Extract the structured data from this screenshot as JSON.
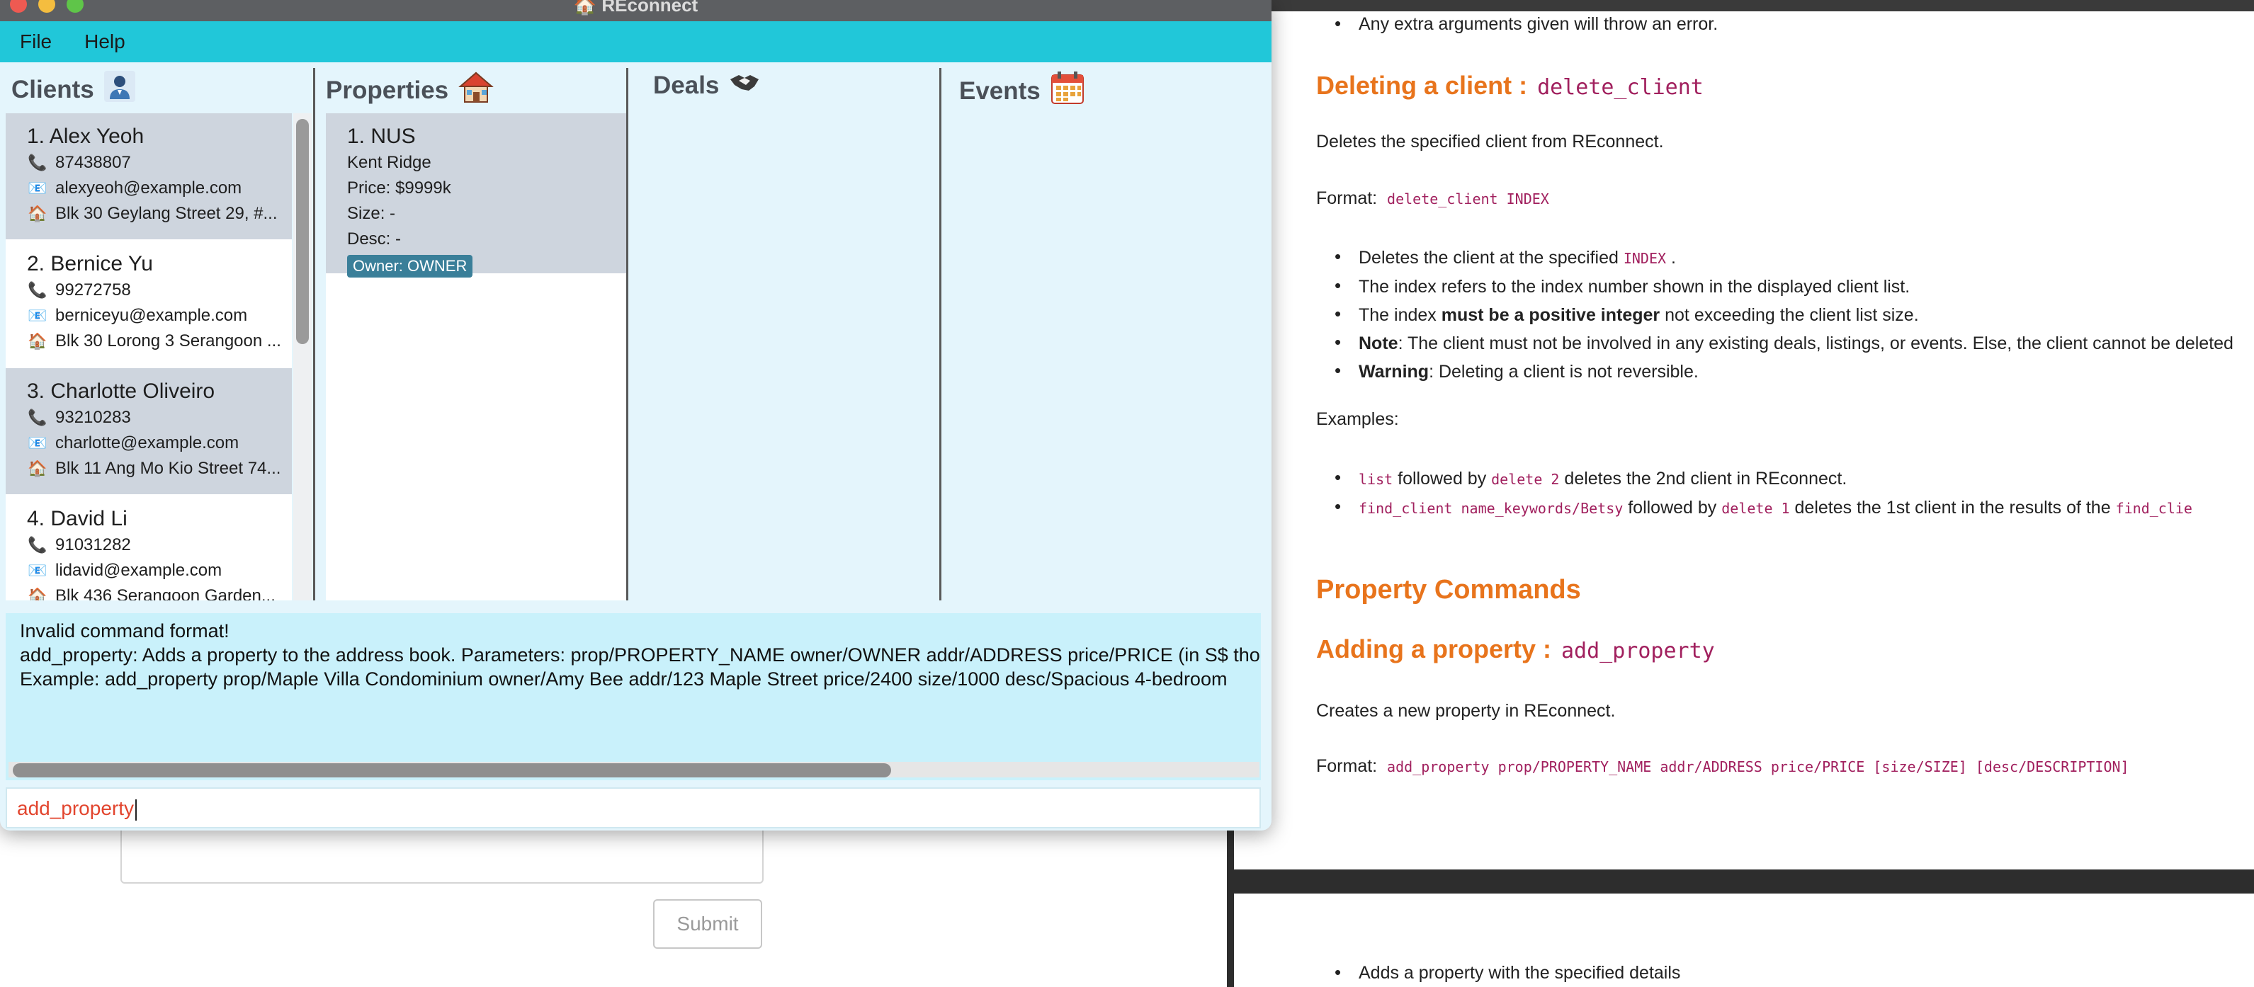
{
  "window": {
    "title": "REconnect"
  },
  "menu": [
    "File",
    "Help"
  ],
  "panels": {
    "clients": {
      "title": "Clients",
      "icon": "person-icon"
    },
    "properties": {
      "title": "Properties",
      "icon": "house-icon"
    },
    "deals": {
      "title": "Deals",
      "icon": "handshake-icon"
    },
    "events": {
      "title": "Events",
      "icon": "calendar-icon"
    }
  },
  "clients": [
    {
      "name": "1. Alex Yeoh",
      "phone": "87438807",
      "email": "alexyeoh@example.com",
      "address": "Blk 30 Geylang Street 29, #..."
    },
    {
      "name": "2. Bernice Yu",
      "phone": "99272758",
      "email": "berniceyu@example.com",
      "address": "Blk 30 Lorong 3 Serangoon ..."
    },
    {
      "name": "3. Charlotte Oliveiro",
      "phone": "93210283",
      "email": "charlotte@example.com",
      "address": "Blk 11 Ang Mo Kio Street 74..."
    },
    {
      "name": "4. David Li",
      "phone": "91031282",
      "email": "lidavid@example.com",
      "address": "Blk 436 Serangoon Garden..."
    }
  ],
  "properties": [
    {
      "name": "1. NUS",
      "address": "Kent Ridge",
      "price": "Price: $9999k",
      "size": "Size: -",
      "desc": "Desc: -",
      "owner_tag": "Owner: OWNER"
    }
  ],
  "result": {
    "line1": "Invalid command format!",
    "line2": "add_property: Adds a property to the address book. Parameters: prop/PROPERTY_NAME owner/OWNER addr/ADDRESS price/PRICE (in S$ tho",
    "line3": "Example: add_property prop/Maple Villa Condominium owner/Amy Bee addr/123 Maple Street price/2400 size/1000 desc/Spacious 4-bedroom"
  },
  "command_input": {
    "value": "add_property"
  },
  "background_form": {
    "submit_label": "Submit"
  },
  "docs": {
    "bullet_top": "Any extra arguments given will throw an error.",
    "delete_heading": "Deleting a client :",
    "delete_code": "delete_client",
    "delete_desc": "Deletes the specified client from REconnect.",
    "format_label": "Format:",
    "delete_format": "delete_client INDEX",
    "b1_pre": "Deletes the client at the specified ",
    "b1_code": "INDEX",
    "b1_post": " .",
    "b2": "The index refers to the index number shown in the displayed client list.",
    "b3_pre": "The index ",
    "b3_bold": "must be a positive integer",
    "b3_post": " not exceeding the client list size.",
    "b4_bold": "Note",
    "b4_text": ": The client must not be involved in any existing deals, listings, or events. Else, the client cannot be deleted",
    "b5_bold": "Warning",
    "b5_text": ": Deleting a client is not reversible.",
    "examples_label": "Examples:",
    "ex1_code1": "list",
    "ex1_mid": " followed by ",
    "ex1_code2": "delete 2",
    "ex1_post": " deletes the 2nd client in REconnect.",
    "ex2_code1": "find_client name_keywords/Betsy",
    "ex2_mid": " followed by ",
    "ex2_code2": "delete 1",
    "ex2_post": " deletes the 1st client in the results of the ",
    "ex2_code3": "find_clie",
    "property_heading": "Property Commands",
    "add_heading": "Adding a property :",
    "add_code": "add_property",
    "add_desc": "Creates a new property in REconnect.",
    "add_format": "add_property prop/PROPERTY_NAME addr/ADDRESS price/PRICE [size/SIZE] [desc/DESCRIPTION]",
    "bottom_bullet": "Adds a property with the specified details"
  },
  "colors": {
    "menubar": "#21c7d9",
    "panel_bg": "#e4f5fc",
    "selected_card": "#ced5de",
    "heading_orange": "#e8741c",
    "code_purple": "#a1205e",
    "command_text": "#e2452e"
  }
}
